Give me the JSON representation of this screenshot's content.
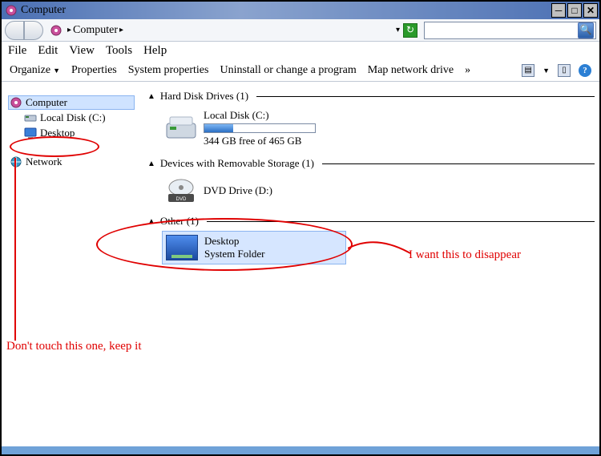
{
  "title": "Computer",
  "breadcrumb": {
    "root": "Computer"
  },
  "menus": {
    "file": "File",
    "edit": "Edit",
    "view": "View",
    "tools": "Tools",
    "help": "Help"
  },
  "toolbar": {
    "organize": "Organize",
    "properties": "Properties",
    "system_properties": "System properties",
    "uninstall": "Uninstall or change a program",
    "map_drive": "Map network drive",
    "overflow": "»"
  },
  "tree": {
    "computer": "Computer",
    "local_disk": "Local Disk (C:)",
    "desktop": "Desktop",
    "network": "Network"
  },
  "groups": {
    "hdd": {
      "label": "Hard Disk Drives (1)"
    },
    "removable": {
      "label": "Devices with Removable Storage (1)"
    },
    "other": {
      "label": "Other (1)"
    }
  },
  "drives": {
    "c": {
      "name": "Local Disk (C:)",
      "free": "344 GB free of 465 GB",
      "used_pct": 26
    },
    "d": {
      "name": "DVD Drive (D:)"
    }
  },
  "desktop_item": {
    "name": "Desktop",
    "type": "System Folder"
  },
  "annotations": {
    "disappear": "I want this to disappear",
    "keep": "Don't touch this one, keep it"
  },
  "search": {
    "placeholder": ""
  }
}
